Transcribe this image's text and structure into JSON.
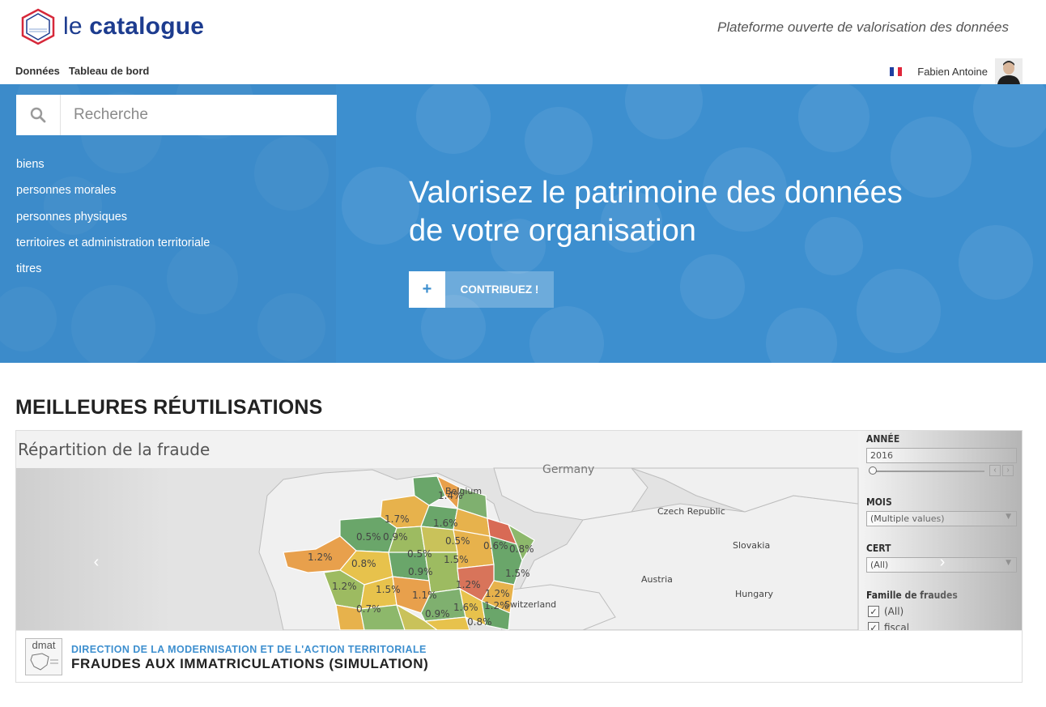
{
  "header": {
    "logo_text_light": "le",
    "logo_text_bold": "catalogue",
    "tagline": "Plateforme ouverte de valorisation des données",
    "nav": [
      "Données",
      "Tableau de bord"
    ],
    "user_name": "Fabien Antoine",
    "flag": "fr-flag"
  },
  "search": {
    "placeholder": "Recherche",
    "icon": "search-icon"
  },
  "categories": [
    "biens",
    "personnes morales",
    "personnes physiques",
    "territoires et administration territoriale",
    "titres"
  ],
  "hero": {
    "title": "Valorisez le patrimoine des données de votre organisation",
    "contribute_plus": "+",
    "contribute_label": "CONTRIBUEZ !"
  },
  "section": {
    "title": "MEILLEURES RÉUTILISATIONS"
  },
  "reuse_card": {
    "preview_title": "Répartition de la fraude",
    "map_labels": {
      "countries": [
        "Germany",
        "Belgium",
        "Czech Republic",
        "Slovakia",
        "Austria",
        "Hungary",
        "Switzerland"
      ],
      "percents": [
        "1.4%",
        "1.7%",
        "1.6%",
        "0.5%",
        "0.9%",
        "0.5%",
        "0.6%",
        "0.8%",
        "1.2%",
        "0.8%",
        "0.5%",
        "1.5%",
        "0.9%",
        "1.5%",
        "1.2%",
        "1.5%",
        "1.2%",
        "1.1%",
        "1.2%",
        "0.7%",
        "1.6%",
        "1.2%",
        "0.9%",
        "0.8%"
      ]
    },
    "filters": {
      "annee_label": "ANNÉE",
      "annee_value": "2016",
      "mois_label": "MOIS",
      "mois_value": "(Multiple values)",
      "cert_label": "CERT",
      "cert_value": "(All)",
      "famille_label": "Famille de fraudes",
      "famille_options": [
        "(All)",
        "fiscal"
      ]
    },
    "org_logo_text": "dmat",
    "org_name": "DIRECTION DE LA MODERNISATION ET DE L'ACTION TERRITORIALE",
    "title": "FRAUDES AUX IMMATRICULATIONS (SIMULATION)",
    "prev_icon": "chevron-left-icon",
    "next_icon": "chevron-right-icon"
  },
  "colors": {
    "brand_blue": "#1d3c8f",
    "hero_blue": "#3d8fcf",
    "org_blue": "#3d8fcf"
  }
}
